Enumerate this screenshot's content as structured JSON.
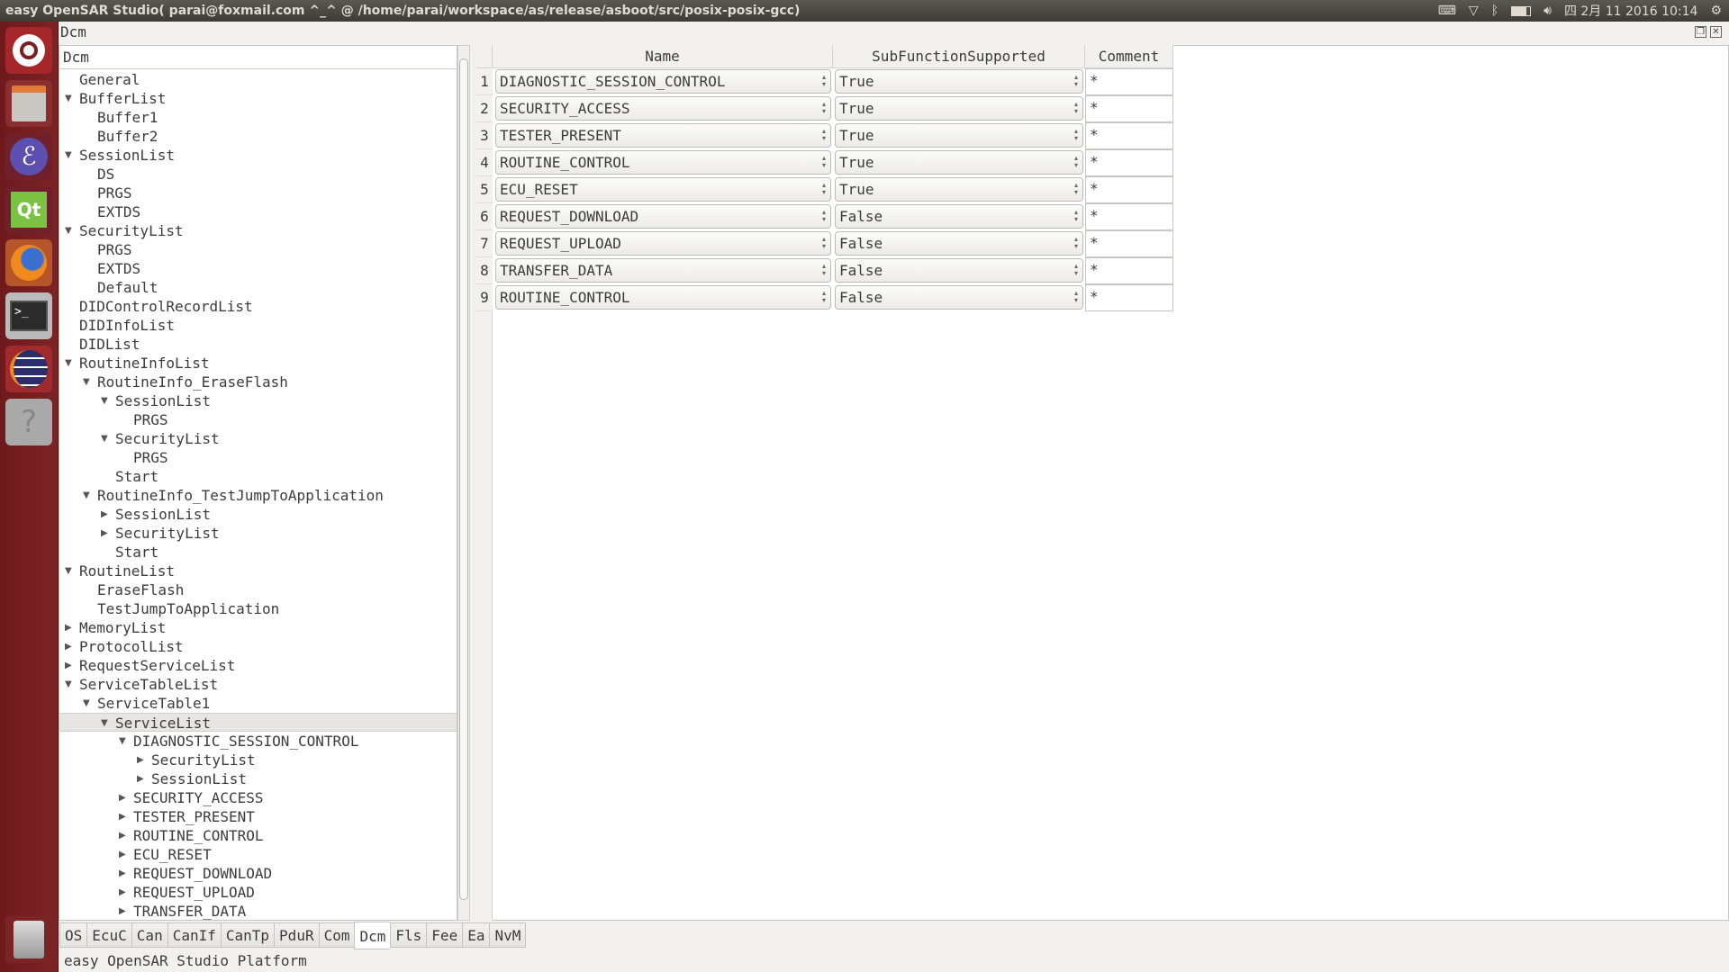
{
  "window": {
    "title": "easy OpenSAR Studio( parai@foxmail.com ^_^ @ /home/parai/workspace/as/release/asboot/src/posix-posix-gcc)",
    "module_label": "Dcm"
  },
  "tray": {
    "weekday": "四",
    "date_time": "2月 11 2016 10:14",
    "icons": [
      "keyboard-icon",
      "wifi-icon",
      "bluetooth-icon",
      "battery-icon",
      "volume-icon",
      "settings-gear-icon"
    ]
  },
  "launcher": {
    "icons": [
      "ubuntu-dash-icon",
      "files-icon",
      "emacs-icon",
      "qt-creator-icon",
      "firefox-icon",
      "terminal-icon",
      "eclipse-icon",
      "help-icon",
      "trash-icon"
    ]
  },
  "tree": {
    "header": "Dcm",
    "items": [
      {
        "label": "General",
        "level": 0,
        "arrow": "none"
      },
      {
        "label": "BufferList",
        "level": 0,
        "arrow": "down"
      },
      {
        "label": "Buffer1",
        "level": 1,
        "arrow": "none"
      },
      {
        "label": "Buffer2",
        "level": 1,
        "arrow": "none"
      },
      {
        "label": "SessionList",
        "level": 0,
        "arrow": "down"
      },
      {
        "label": "DS",
        "level": 1,
        "arrow": "none"
      },
      {
        "label": "PRGS",
        "level": 1,
        "arrow": "none"
      },
      {
        "label": "EXTDS",
        "level": 1,
        "arrow": "none"
      },
      {
        "label": "SecurityList",
        "level": 0,
        "arrow": "down"
      },
      {
        "label": "PRGS",
        "level": 1,
        "arrow": "none"
      },
      {
        "label": "EXTDS",
        "level": 1,
        "arrow": "none"
      },
      {
        "label": "Default",
        "level": 1,
        "arrow": "none"
      },
      {
        "label": "DIDControlRecordList",
        "level": 0,
        "arrow": "none"
      },
      {
        "label": "DIDInfoList",
        "level": 0,
        "arrow": "none"
      },
      {
        "label": "DIDList",
        "level": 0,
        "arrow": "none"
      },
      {
        "label": "RoutineInfoList",
        "level": 0,
        "arrow": "down"
      },
      {
        "label": "RoutineInfo_EraseFlash",
        "level": 1,
        "arrow": "down"
      },
      {
        "label": "SessionList",
        "level": 2,
        "arrow": "down"
      },
      {
        "label": "PRGS",
        "level": 3,
        "arrow": "none"
      },
      {
        "label": "SecurityList",
        "level": 2,
        "arrow": "down"
      },
      {
        "label": "PRGS",
        "level": 3,
        "arrow": "none"
      },
      {
        "label": "Start",
        "level": 2,
        "arrow": "none"
      },
      {
        "label": "RoutineInfo_TestJumpToApplication",
        "level": 1,
        "arrow": "down"
      },
      {
        "label": "SessionList",
        "level": 2,
        "arrow": "right"
      },
      {
        "label": "SecurityList",
        "level": 2,
        "arrow": "right"
      },
      {
        "label": "Start",
        "level": 2,
        "arrow": "none"
      },
      {
        "label": "RoutineList",
        "level": 0,
        "arrow": "down"
      },
      {
        "label": "EraseFlash",
        "level": 1,
        "arrow": "none"
      },
      {
        "label": "TestJumpToApplication",
        "level": 1,
        "arrow": "none"
      },
      {
        "label": "MemoryList",
        "level": 0,
        "arrow": "right"
      },
      {
        "label": "ProtocolList",
        "level": 0,
        "arrow": "right"
      },
      {
        "label": "RequestServiceList",
        "level": 0,
        "arrow": "right"
      },
      {
        "label": "ServiceTableList",
        "level": 0,
        "arrow": "down"
      },
      {
        "label": "ServiceTable1",
        "level": 1,
        "arrow": "down"
      },
      {
        "label": "ServiceList",
        "level": 2,
        "arrow": "down",
        "selected": true
      },
      {
        "label": "DIAGNOSTIC_SESSION_CONTROL",
        "level": 3,
        "arrow": "down"
      },
      {
        "label": "SecurityList",
        "level": 4,
        "arrow": "right"
      },
      {
        "label": "SessionList",
        "level": 4,
        "arrow": "right"
      },
      {
        "label": "SECURITY_ACCESS",
        "level": 3,
        "arrow": "right"
      },
      {
        "label": "TESTER_PRESENT",
        "level": 3,
        "arrow": "right"
      },
      {
        "label": "ROUTINE_CONTROL",
        "level": 3,
        "arrow": "right"
      },
      {
        "label": "ECU_RESET",
        "level": 3,
        "arrow": "right"
      },
      {
        "label": "REQUEST_DOWNLOAD",
        "level": 3,
        "arrow": "right"
      },
      {
        "label": "REQUEST_UPLOAD",
        "level": 3,
        "arrow": "right"
      },
      {
        "label": "TRANSFER_DATA",
        "level": 3,
        "arrow": "right"
      }
    ]
  },
  "table": {
    "columns": [
      "Name",
      "SubFunctionSupported",
      "Comment"
    ],
    "rows": [
      {
        "num": "1",
        "name": "DIAGNOSTIC_SESSION_CONTROL",
        "sub": "True",
        "comment": "*"
      },
      {
        "num": "2",
        "name": "SECURITY_ACCESS",
        "sub": "True",
        "comment": "*"
      },
      {
        "num": "3",
        "name": "TESTER_PRESENT",
        "sub": "True",
        "comment": "*"
      },
      {
        "num": "4",
        "name": "ROUTINE_CONTROL",
        "sub": "True",
        "comment": "*"
      },
      {
        "num": "5",
        "name": "ECU_RESET",
        "sub": "True",
        "comment": "*"
      },
      {
        "num": "6",
        "name": "REQUEST_DOWNLOAD",
        "sub": "False",
        "comment": "*"
      },
      {
        "num": "7",
        "name": "REQUEST_UPLOAD",
        "sub": "False",
        "comment": "*"
      },
      {
        "num": "8",
        "name": "TRANSFER_DATA",
        "sub": "False",
        "comment": "*"
      },
      {
        "num": "9",
        "name": "ROUTINE_CONTROL",
        "sub": "False",
        "comment": "*"
      }
    ]
  },
  "tabs": {
    "items": [
      "OS",
      "EcuC",
      "Can",
      "CanIf",
      "CanTp",
      "PduR",
      "Com",
      "Dcm",
      "Fls",
      "Fee",
      "Ea",
      "NvM"
    ],
    "active": "Dcm"
  },
  "status": {
    "text": "easy OpenSAR Studio Platform"
  }
}
